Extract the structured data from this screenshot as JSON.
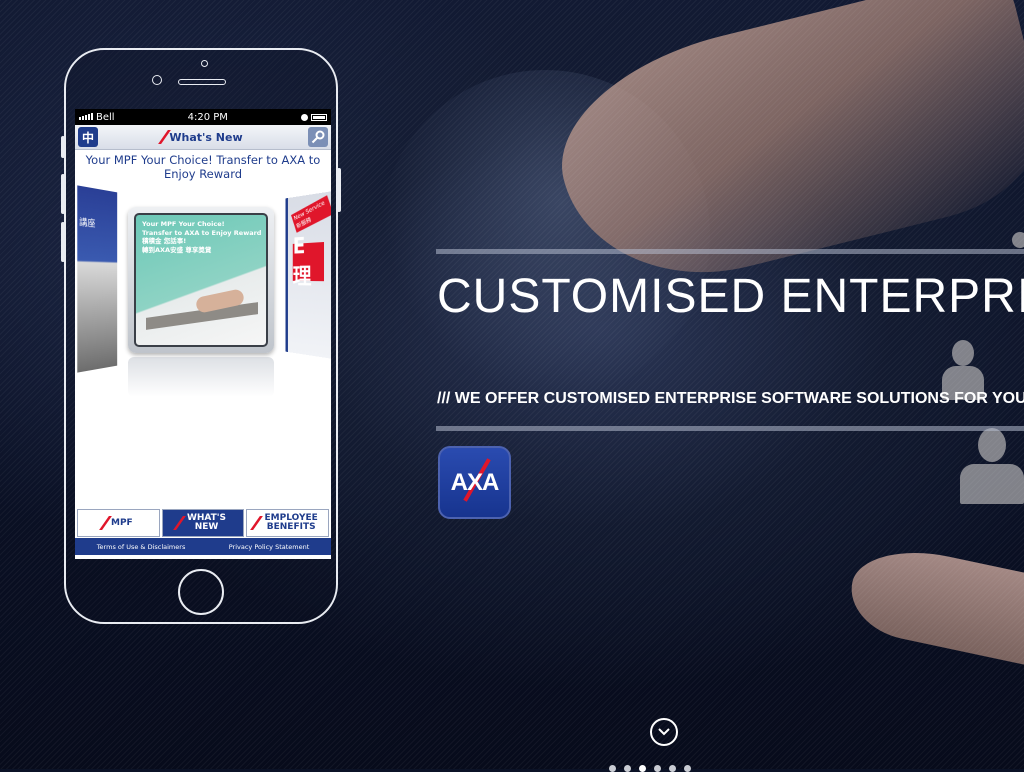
{
  "hero": {
    "title": "CUSTOMISED ENTERPRISE SOLUTIONS",
    "subtitle": "/// WE OFFER CUSTOMISED ENTERPRISE SOFTWARE SOLUTIONS FOR YOU"
  },
  "app_icon": {
    "label": "AXA",
    "colors": {
      "brand_blue": "#1f3c8c",
      "brand_red": "#e0162b"
    }
  },
  "phone": {
    "status_bar": {
      "carrier": "Bell",
      "time": "4:20 PM"
    },
    "nav": {
      "lang_button": "中",
      "title": "What's New"
    },
    "promo_title": "Your MPF Your Choice! Transfer to AXA to Enjoy Reward",
    "carousel": {
      "left_card_text": "講座",
      "center_card_text": [
        "Your MPF Your Choice!",
        "Transfer to AXA to Enjoy Reward",
        "積積金 您話事!",
        "轉到AXA安盛 尊享獎賞"
      ],
      "right_card_tag": "New Service 新服務",
      "right_card_glyph": "E理"
    },
    "tabs": [
      {
        "label": "MPF"
      },
      {
        "label": "WHAT'S NEW"
      },
      {
        "label": "EMPLOYEE BENEFITS"
      }
    ],
    "footer": {
      "terms": "Terms of Use & Disclaimers",
      "privacy": "Privacy Policy Statement"
    }
  },
  "pagination": {
    "count": 6,
    "active": 2
  }
}
